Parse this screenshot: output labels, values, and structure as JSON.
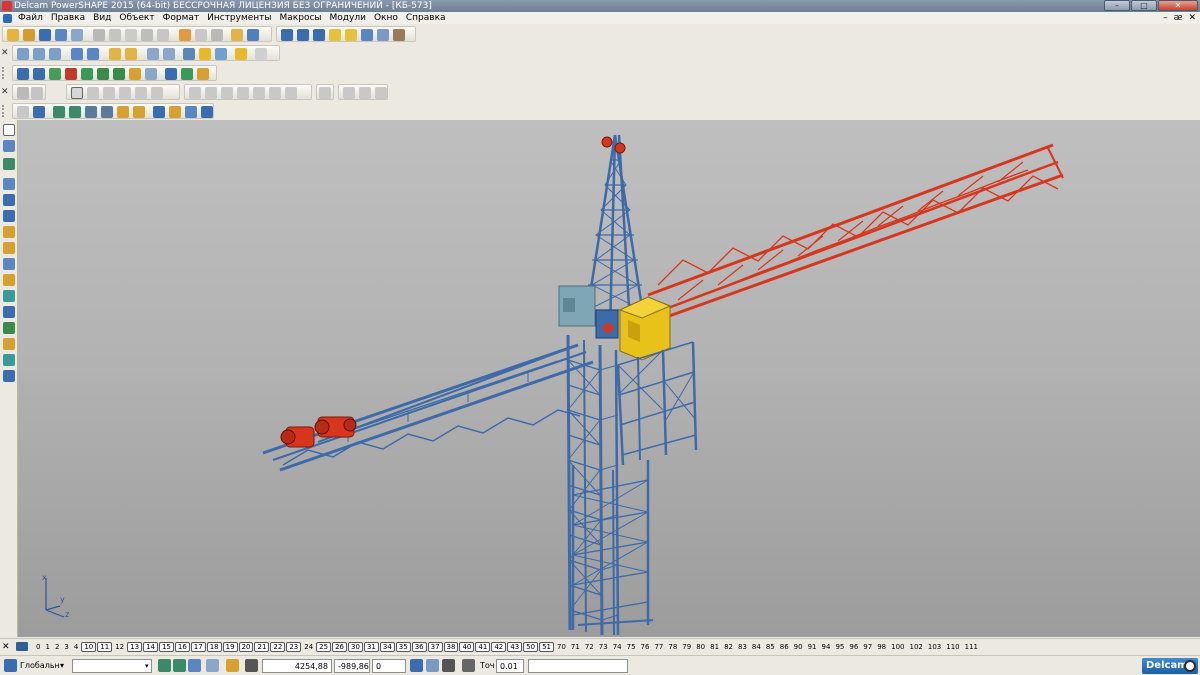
{
  "window": {
    "title": "Delcam PowerSHAPE 2015 (64-bit) БЕССРОЧНАЯ ЛИЦЕНЗИЯ БЕЗ ОГРАНИЧЕНИЙ - [КБ-573]",
    "minimize": "–",
    "maximize": "□",
    "close": "✕"
  },
  "menu": {
    "items": [
      "Файл",
      "Правка",
      "Вид",
      "Объект",
      "Формат",
      "Инструменты",
      "Макросы",
      "Модули",
      "Окно",
      "Справка"
    ],
    "mdi_min": "–",
    "mdi_restore": "ᴂ",
    "mdi_close": "✕"
  },
  "levels": {
    "items": [
      {
        "n": "0",
        "boxed": false
      },
      {
        "n": "1",
        "boxed": false
      },
      {
        "n": "2",
        "boxed": false
      },
      {
        "n": "3",
        "boxed": false
      },
      {
        "n": "4",
        "boxed": false
      },
      {
        "n": "10",
        "boxed": true
      },
      {
        "n": "11",
        "boxed": true
      },
      {
        "n": "12",
        "boxed": false
      },
      {
        "n": "13",
        "boxed": true
      },
      {
        "n": "14",
        "boxed": true
      },
      {
        "n": "15",
        "boxed": true
      },
      {
        "n": "16",
        "boxed": true
      },
      {
        "n": "17",
        "boxed": true
      },
      {
        "n": "18",
        "boxed": true
      },
      {
        "n": "19",
        "boxed": true
      },
      {
        "n": "20",
        "boxed": true
      },
      {
        "n": "21",
        "boxed": true
      },
      {
        "n": "22",
        "boxed": true
      },
      {
        "n": "23",
        "boxed": true
      },
      {
        "n": "24",
        "boxed": false
      },
      {
        "n": "25",
        "boxed": true
      },
      {
        "n": "26",
        "boxed": true
      },
      {
        "n": "30",
        "boxed": true
      },
      {
        "n": "31",
        "boxed": true
      },
      {
        "n": "34",
        "boxed": true
      },
      {
        "n": "35",
        "boxed": true
      },
      {
        "n": "36",
        "boxed": true
      },
      {
        "n": "37",
        "boxed": true
      },
      {
        "n": "38",
        "boxed": true
      },
      {
        "n": "40",
        "boxed": true
      },
      {
        "n": "41",
        "boxed": true
      },
      {
        "n": "42",
        "boxed": true
      },
      {
        "n": "43",
        "boxed": true
      },
      {
        "n": "50",
        "boxed": true
      },
      {
        "n": "51",
        "boxed": true
      },
      {
        "n": "70",
        "boxed": false
      },
      {
        "n": "71",
        "boxed": false
      },
      {
        "n": "72",
        "boxed": false
      },
      {
        "n": "73",
        "boxed": false
      },
      {
        "n": "74",
        "boxed": false
      },
      {
        "n": "75",
        "boxed": false
      },
      {
        "n": "76",
        "boxed": false
      },
      {
        "n": "77",
        "boxed": false
      },
      {
        "n": "78",
        "boxed": false
      },
      {
        "n": "79",
        "boxed": false
      },
      {
        "n": "80",
        "boxed": false
      },
      {
        "n": "81",
        "boxed": false
      },
      {
        "n": "82",
        "boxed": false
      },
      {
        "n": "83",
        "boxed": false
      },
      {
        "n": "84",
        "boxed": false
      },
      {
        "n": "85",
        "boxed": false
      },
      {
        "n": "86",
        "boxed": false
      },
      {
        "n": "90",
        "boxed": false
      },
      {
        "n": "91",
        "boxed": false
      },
      {
        "n": "94",
        "boxed": false
      },
      {
        "n": "95",
        "boxed": false
      },
      {
        "n": "96",
        "boxed": false
      },
      {
        "n": "97",
        "boxed": false
      },
      {
        "n": "98",
        "boxed": false
      },
      {
        "n": "100",
        "boxed": false
      },
      {
        "n": "102",
        "boxed": false
      },
      {
        "n": "103",
        "boxed": false
      },
      {
        "n": "110",
        "boxed": false
      },
      {
        "n": "111",
        "boxed": false
      }
    ]
  },
  "status": {
    "workplane": "Глобальн",
    "dropdown_arrow": "▾",
    "x": "4254,88",
    "y": "-989,86",
    "z": "0",
    "tolerance_label": "Точ",
    "tolerance_value": "0.01",
    "logo": "Delcam"
  },
  "colors": {
    "tower_blue": "#3d6aa8",
    "jib_red": "#d8361c",
    "cab_yellow": "#e8c21a",
    "machinery_teal": "#7fa6b4"
  }
}
